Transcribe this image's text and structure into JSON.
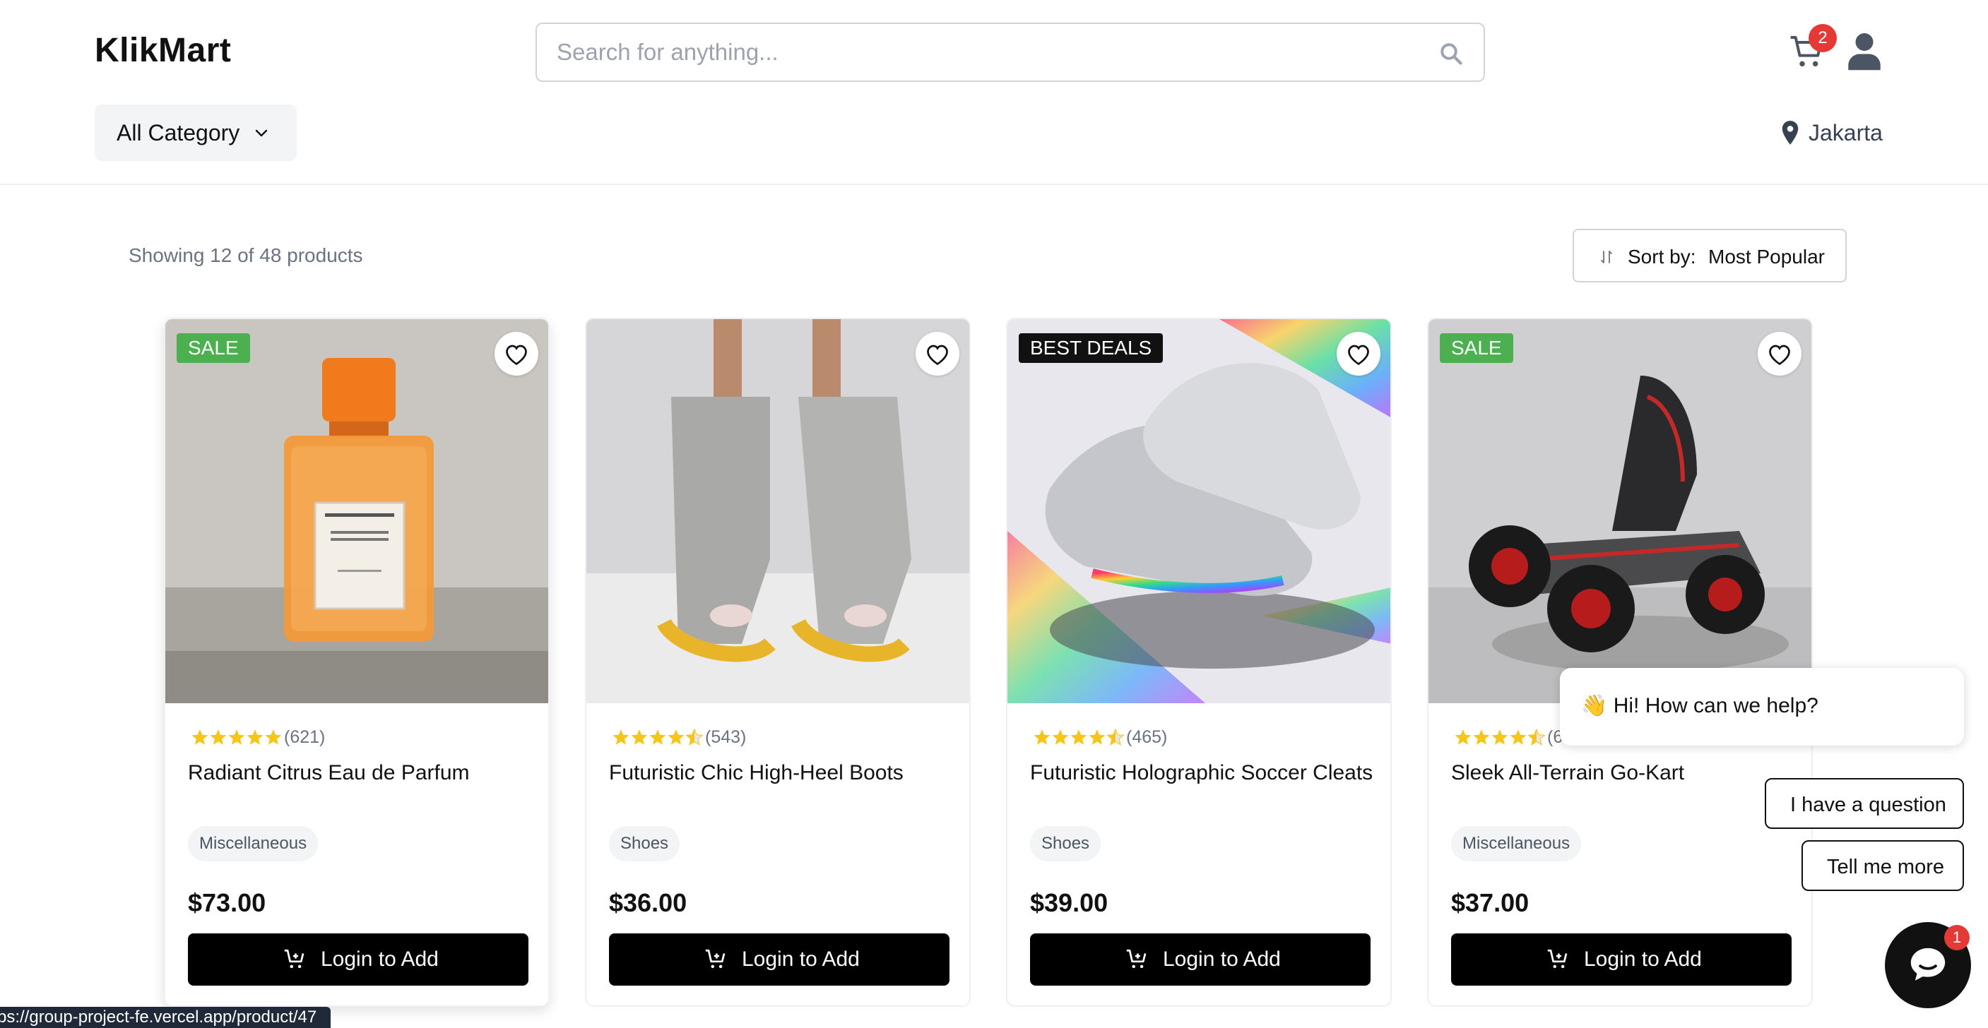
{
  "header": {
    "logo": "KlikMart",
    "search_placeholder": "Search for anything...",
    "cart_count": "2",
    "category_label": "All Category",
    "location": "Jakarta"
  },
  "toolbar": {
    "showing": "Showing 12 of 48 products",
    "sort_label": "Sort by:",
    "sort_value": "Most Popular"
  },
  "products": [
    {
      "badge": "SALE",
      "reviews": "(621)",
      "rating": 5,
      "name": "Radiant Citrus Eau de Parfum",
      "category": "Miscellaneous",
      "price": "$73.00",
      "cta": "Login to Add"
    },
    {
      "badge": "",
      "reviews": "(543)",
      "rating": 4.5,
      "name": "Futuristic Chic High-Heel Boots",
      "category": "Shoes",
      "price": "$36.00",
      "cta": "Login to Add"
    },
    {
      "badge": "BEST DEALS",
      "reviews": "(465)",
      "rating": 4.5,
      "name": "Futuristic Holographic Soccer Cleats",
      "category": "Shoes",
      "price": "$39.00",
      "cta": "Login to Add"
    },
    {
      "badge": "SALE",
      "reviews": "(6",
      "rating": 4.5,
      "name": "Sleek All-Terrain Go-Kart",
      "category": "Miscellaneous",
      "price": "$37.00",
      "cta": "Login to Add"
    }
  ],
  "chat": {
    "greeting": "👋 Hi! How can we help?",
    "option1": "I have a question",
    "option2": "Tell me more",
    "unread": "1"
  },
  "status_url": "ps://group-project-fe.vercel.app/product/47",
  "colors": {
    "sale": "#4caf50",
    "deal": "#111111",
    "star": "#f5c518",
    "badge": "#e53935"
  }
}
